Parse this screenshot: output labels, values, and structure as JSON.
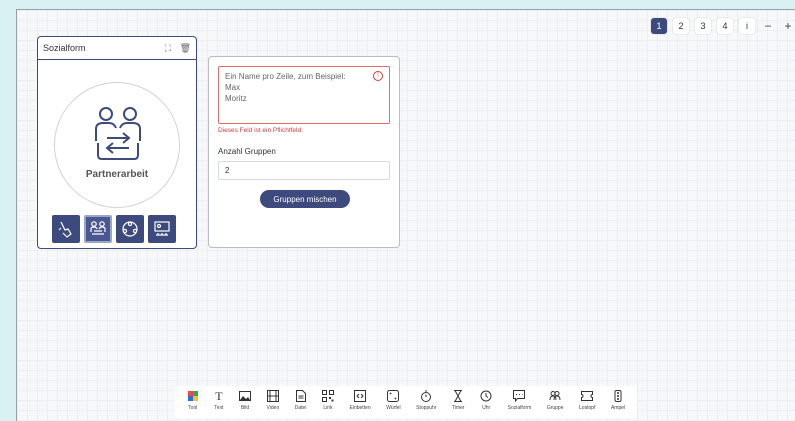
{
  "pages": {
    "items": [
      "1",
      "2",
      "3",
      "4",
      "i"
    ],
    "active": "1",
    "zoom_out": "−",
    "zoom_in": "+"
  },
  "sozialform": {
    "title": "Sozialform",
    "fullscreen_icon": "⛶",
    "delete_icon": "🗑",
    "mode_label": "Partnerarbeit",
    "modes": [
      "Einzelarbeit",
      "Partnerarbeit",
      "Gruppenarbeit",
      "Plenum"
    ],
    "active_mode": "Partnerarbeit"
  },
  "grouper": {
    "names_placeholder": "Ein Name pro Zeile, zum Beispiel:\nMax\nMoritz",
    "names_line1": "Ein Name pro Zeile, zum Beispiel:",
    "names_line2": "Max",
    "names_line3": "Moritz",
    "error": "Dieses Feld ist ein Pflichtfeld.",
    "count_label": "Anzahl Gruppen",
    "count_value": "2",
    "mix_button": "Gruppen mischen"
  },
  "toolbar": {
    "tools": [
      {
        "label": "Tool",
        "icon": "tool-icon"
      },
      {
        "label": "Text",
        "icon": "text-icon"
      },
      {
        "label": "Bild",
        "icon": "image-icon"
      },
      {
        "label": "Video",
        "icon": "video-icon"
      },
      {
        "label": "Datei",
        "icon": "file-icon"
      },
      {
        "label": "Link",
        "icon": "qr-icon"
      },
      {
        "label": "Einbetten",
        "icon": "embed-icon"
      },
      {
        "label": "Würfel",
        "icon": "dice-icon"
      },
      {
        "label": "Stoppuhr",
        "icon": "stopwatch-icon"
      },
      {
        "label": "Timer",
        "icon": "hourglass-icon"
      },
      {
        "label": "Uhr",
        "icon": "clock-icon"
      },
      {
        "label": "Sozialform",
        "icon": "chat-icon"
      },
      {
        "label": "Gruppe",
        "icon": "group-icon"
      },
      {
        "label": "Lostopf",
        "icon": "ticket-icon"
      },
      {
        "label": "Ampel",
        "icon": "traffic-light-icon"
      }
    ]
  },
  "colors": {
    "accent": "#3d4a7d",
    "error": "#d23c3c",
    "background": "#d9f1f2"
  }
}
